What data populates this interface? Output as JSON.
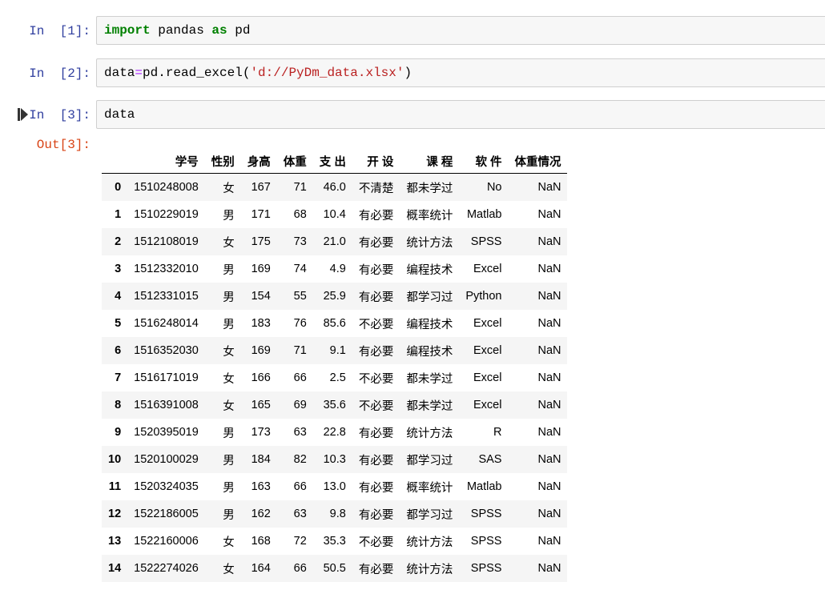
{
  "cells": [
    {
      "prompt": "In  [1]:",
      "code": [
        {
          "t": "import",
          "c": "kw"
        },
        {
          "t": " pandas ",
          "c": "p"
        },
        {
          "t": "as",
          "c": "kw"
        },
        {
          "t": " pd",
          "c": "p"
        }
      ]
    },
    {
      "prompt": "In  [2]:",
      "code": [
        {
          "t": "data",
          "c": "p"
        },
        {
          "t": "=",
          "c": "op"
        },
        {
          "t": "pd.read_excel(",
          "c": "p"
        },
        {
          "t": "'d://PyDm_data.xlsx'",
          "c": "str"
        },
        {
          "t": ")",
          "c": "p"
        }
      ]
    },
    {
      "prompt": "In  [3]:",
      "code": [
        {
          "t": "data",
          "c": "p"
        }
      ]
    }
  ],
  "output": {
    "prompt": "Out[3]:",
    "columns": [
      "学号",
      "性别",
      "身高",
      "体重",
      "支 出",
      "开 设",
      "课 程",
      "软 件",
      "体重情况"
    ],
    "rows": [
      [
        "0",
        "1510248008",
        "女",
        "167",
        "71",
        "46.0",
        "不清楚",
        "都未学过",
        "No",
        "NaN"
      ],
      [
        "1",
        "1510229019",
        "男",
        "171",
        "68",
        "10.4",
        "有必要",
        "概率统计",
        "Matlab",
        "NaN"
      ],
      [
        "2",
        "1512108019",
        "女",
        "175",
        "73",
        "21.0",
        "有必要",
        "统计方法",
        "SPSS",
        "NaN"
      ],
      [
        "3",
        "1512332010",
        "男",
        "169",
        "74",
        "4.9",
        "有必要",
        "编程技术",
        "Excel",
        "NaN"
      ],
      [
        "4",
        "1512331015",
        "男",
        "154",
        "55",
        "25.9",
        "有必要",
        "都学习过",
        "Python",
        "NaN"
      ],
      [
        "5",
        "1516248014",
        "男",
        "183",
        "76",
        "85.6",
        "不必要",
        "编程技术",
        "Excel",
        "NaN"
      ],
      [
        "6",
        "1516352030",
        "女",
        "169",
        "71",
        "9.1",
        "有必要",
        "编程技术",
        "Excel",
        "NaN"
      ],
      [
        "7",
        "1516171019",
        "女",
        "166",
        "66",
        "2.5",
        "不必要",
        "都未学过",
        "Excel",
        "NaN"
      ],
      [
        "8",
        "1516391008",
        "女",
        "165",
        "69",
        "35.6",
        "不必要",
        "都未学过",
        "Excel",
        "NaN"
      ],
      [
        "9",
        "1520395019",
        "男",
        "173",
        "63",
        "22.8",
        "有必要",
        "统计方法",
        "R",
        "NaN"
      ],
      [
        "10",
        "1520100029",
        "男",
        "184",
        "82",
        "10.3",
        "有必要",
        "都学习过",
        "SAS",
        "NaN"
      ],
      [
        "11",
        "1520324035",
        "男",
        "163",
        "66",
        "13.0",
        "有必要",
        "概率统计",
        "Matlab",
        "NaN"
      ],
      [
        "12",
        "1522186005",
        "男",
        "162",
        "63",
        "9.8",
        "有必要",
        "都学习过",
        "SPSS",
        "NaN"
      ],
      [
        "13",
        "1522160006",
        "女",
        "168",
        "72",
        "35.3",
        "不必要",
        "统计方法",
        "SPSS",
        "NaN"
      ],
      [
        "14",
        "1522274026",
        "女",
        "164",
        "66",
        "50.5",
        "有必要",
        "统计方法",
        "SPSS",
        "NaN"
      ]
    ]
  },
  "colors": {
    "prompt_in": "#303f9f",
    "prompt_out": "#d84315",
    "keyword": "#008000",
    "operator": "#aa22ff",
    "string": "#ba2121",
    "cell_bg": "#f7f7f7",
    "row_stripe": "#f5f5f5"
  }
}
